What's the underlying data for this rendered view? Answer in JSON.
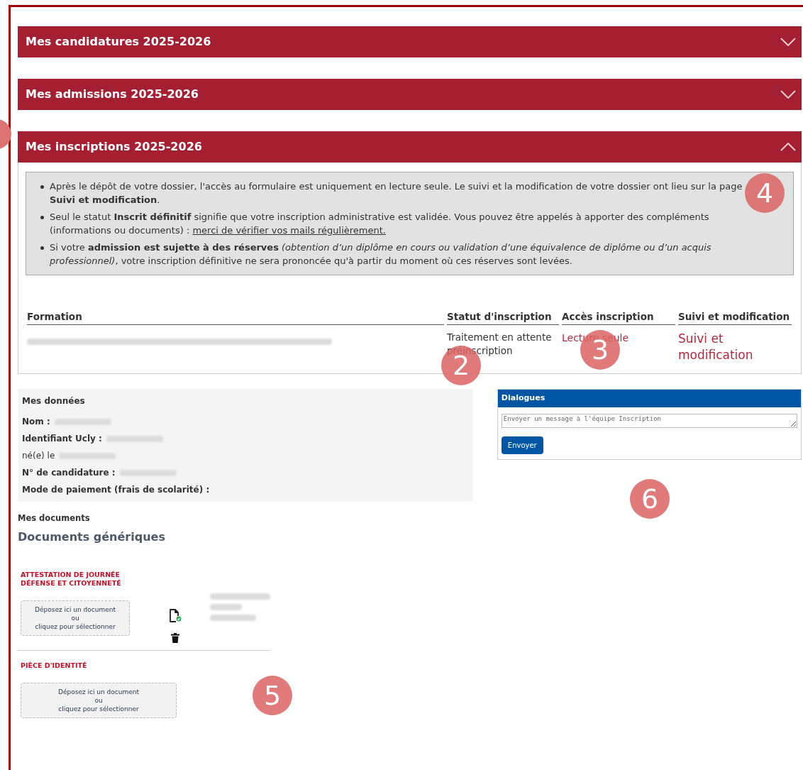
{
  "accordions": [
    {
      "title": "Mes candidatures 2025-2026",
      "expanded": false
    },
    {
      "title": "Mes admissions 2025-2026",
      "expanded": false
    },
    {
      "title": "Mes inscriptions 2025-2026",
      "expanded": true
    }
  ],
  "notice": [
    {
      "text": "Après le dépôt de votre dossier, l'accès au formulaire est uniquement en lecture seule. Le suivi et la modification de votre dossier ont lieu sur la page **Suivi et modification**."
    },
    {
      "text": "Seul le statut **Inscrit définitif** signifie que votre inscription administrative est validée. Vous pouvez être appelés à apporter des compléments (informations ou documents) : ",
      "link": "merci de vérifier vos mails régulièrement."
    },
    {
      "text": "Si votre **admission est sujette à des réserves** *(obtention d’un diplôme en cours ou validation d’une équivalence de diplôme ou d’un acquis professionnel)*, votre inscription définitive ne sera prononcée qu'à partir du moment où ces réserves sont levées."
    }
  ],
  "table": {
    "columns": [
      "Formation",
      "Statut d'inscription",
      "Accès inscription",
      "Suivi et modification"
    ],
    "rows": [
      {
        "status": "Traitement en attente préinscription",
        "access": "Lecture seule",
        "follow": "Suivi et modification"
      }
    ]
  },
  "my_data": {
    "title": "Mes données",
    "fields": [
      {
        "label": "Nom :",
        "bold": true,
        "redacted": true
      },
      {
        "label": "Identifiant Ucly :",
        "bold": true,
        "redacted": true
      },
      {
        "label": "né(e) le",
        "bold": false,
        "redacted": true
      },
      {
        "label": "N° de candidature :",
        "bold": true,
        "redacted": true
      },
      {
        "label": "Mode de paiement (frais de scolarité) :",
        "bold": true,
        "redacted": false
      }
    ]
  },
  "dialogues": {
    "title": "Dialogues",
    "placeholder": "Envoyer un message à l'équipe Inscription",
    "button": "Envoyer"
  },
  "documents": {
    "heading": "Mes documents",
    "subheading": "Documents génériques",
    "items": [
      {
        "title": "ATTESTATION DE JOURNÉE DÉFENSE ET CITOYENNETÉ",
        "dropzone": [
          "Déposez ici un document",
          "ou",
          "cliquez pour sélectionner"
        ],
        "uploaded": true
      },
      {
        "title": "PIÈCE D'IDENTITÉ",
        "dropzone": [
          "Déposez ici un document",
          "ou",
          "cliquez pour sélectionner"
        ],
        "uploaded": false
      }
    ]
  },
  "markers": [
    "2",
    "3",
    "4",
    "5",
    "6"
  ]
}
